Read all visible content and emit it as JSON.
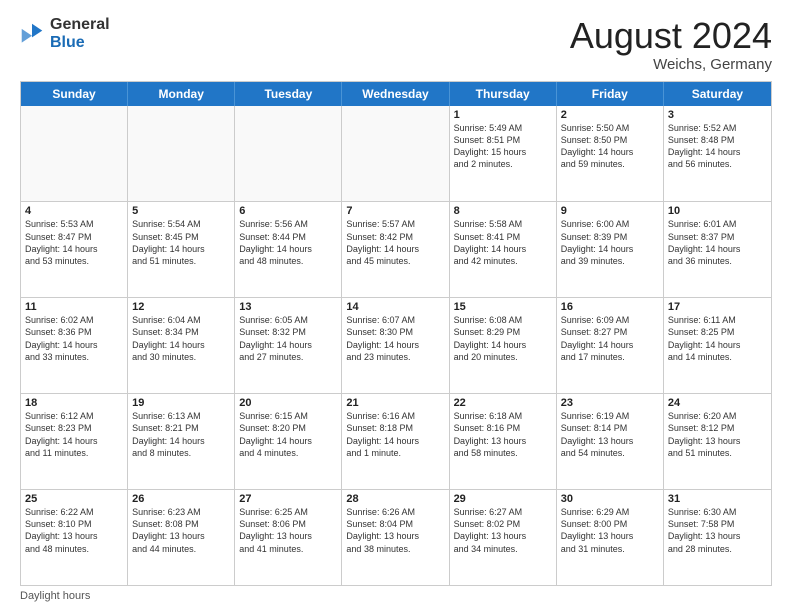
{
  "logo": {
    "general": "General",
    "blue": "Blue"
  },
  "header": {
    "month": "August 2024",
    "location": "Weichs, Germany"
  },
  "days_of_week": [
    "Sunday",
    "Monday",
    "Tuesday",
    "Wednesday",
    "Thursday",
    "Friday",
    "Saturday"
  ],
  "footer": "Daylight hours",
  "weeks": [
    [
      {
        "num": "",
        "info": ""
      },
      {
        "num": "",
        "info": ""
      },
      {
        "num": "",
        "info": ""
      },
      {
        "num": "",
        "info": ""
      },
      {
        "num": "1",
        "info": "Sunrise: 5:49 AM\nSunset: 8:51 PM\nDaylight: 15 hours\nand 2 minutes."
      },
      {
        "num": "2",
        "info": "Sunrise: 5:50 AM\nSunset: 8:50 PM\nDaylight: 14 hours\nand 59 minutes."
      },
      {
        "num": "3",
        "info": "Sunrise: 5:52 AM\nSunset: 8:48 PM\nDaylight: 14 hours\nand 56 minutes."
      }
    ],
    [
      {
        "num": "4",
        "info": "Sunrise: 5:53 AM\nSunset: 8:47 PM\nDaylight: 14 hours\nand 53 minutes."
      },
      {
        "num": "5",
        "info": "Sunrise: 5:54 AM\nSunset: 8:45 PM\nDaylight: 14 hours\nand 51 minutes."
      },
      {
        "num": "6",
        "info": "Sunrise: 5:56 AM\nSunset: 8:44 PM\nDaylight: 14 hours\nand 48 minutes."
      },
      {
        "num": "7",
        "info": "Sunrise: 5:57 AM\nSunset: 8:42 PM\nDaylight: 14 hours\nand 45 minutes."
      },
      {
        "num": "8",
        "info": "Sunrise: 5:58 AM\nSunset: 8:41 PM\nDaylight: 14 hours\nand 42 minutes."
      },
      {
        "num": "9",
        "info": "Sunrise: 6:00 AM\nSunset: 8:39 PM\nDaylight: 14 hours\nand 39 minutes."
      },
      {
        "num": "10",
        "info": "Sunrise: 6:01 AM\nSunset: 8:37 PM\nDaylight: 14 hours\nand 36 minutes."
      }
    ],
    [
      {
        "num": "11",
        "info": "Sunrise: 6:02 AM\nSunset: 8:36 PM\nDaylight: 14 hours\nand 33 minutes."
      },
      {
        "num": "12",
        "info": "Sunrise: 6:04 AM\nSunset: 8:34 PM\nDaylight: 14 hours\nand 30 minutes."
      },
      {
        "num": "13",
        "info": "Sunrise: 6:05 AM\nSunset: 8:32 PM\nDaylight: 14 hours\nand 27 minutes."
      },
      {
        "num": "14",
        "info": "Sunrise: 6:07 AM\nSunset: 8:30 PM\nDaylight: 14 hours\nand 23 minutes."
      },
      {
        "num": "15",
        "info": "Sunrise: 6:08 AM\nSunset: 8:29 PM\nDaylight: 14 hours\nand 20 minutes."
      },
      {
        "num": "16",
        "info": "Sunrise: 6:09 AM\nSunset: 8:27 PM\nDaylight: 14 hours\nand 17 minutes."
      },
      {
        "num": "17",
        "info": "Sunrise: 6:11 AM\nSunset: 8:25 PM\nDaylight: 14 hours\nand 14 minutes."
      }
    ],
    [
      {
        "num": "18",
        "info": "Sunrise: 6:12 AM\nSunset: 8:23 PM\nDaylight: 14 hours\nand 11 minutes."
      },
      {
        "num": "19",
        "info": "Sunrise: 6:13 AM\nSunset: 8:21 PM\nDaylight: 14 hours\nand 8 minutes."
      },
      {
        "num": "20",
        "info": "Sunrise: 6:15 AM\nSunset: 8:20 PM\nDaylight: 14 hours\nand 4 minutes."
      },
      {
        "num": "21",
        "info": "Sunrise: 6:16 AM\nSunset: 8:18 PM\nDaylight: 14 hours\nand 1 minute."
      },
      {
        "num": "22",
        "info": "Sunrise: 6:18 AM\nSunset: 8:16 PM\nDaylight: 13 hours\nand 58 minutes."
      },
      {
        "num": "23",
        "info": "Sunrise: 6:19 AM\nSunset: 8:14 PM\nDaylight: 13 hours\nand 54 minutes."
      },
      {
        "num": "24",
        "info": "Sunrise: 6:20 AM\nSunset: 8:12 PM\nDaylight: 13 hours\nand 51 minutes."
      }
    ],
    [
      {
        "num": "25",
        "info": "Sunrise: 6:22 AM\nSunset: 8:10 PM\nDaylight: 13 hours\nand 48 minutes."
      },
      {
        "num": "26",
        "info": "Sunrise: 6:23 AM\nSunset: 8:08 PM\nDaylight: 13 hours\nand 44 minutes."
      },
      {
        "num": "27",
        "info": "Sunrise: 6:25 AM\nSunset: 8:06 PM\nDaylight: 13 hours\nand 41 minutes."
      },
      {
        "num": "28",
        "info": "Sunrise: 6:26 AM\nSunset: 8:04 PM\nDaylight: 13 hours\nand 38 minutes."
      },
      {
        "num": "29",
        "info": "Sunrise: 6:27 AM\nSunset: 8:02 PM\nDaylight: 13 hours\nand 34 minutes."
      },
      {
        "num": "30",
        "info": "Sunrise: 6:29 AM\nSunset: 8:00 PM\nDaylight: 13 hours\nand 31 minutes."
      },
      {
        "num": "31",
        "info": "Sunrise: 6:30 AM\nSunset: 7:58 PM\nDaylight: 13 hours\nand 28 minutes."
      }
    ]
  ]
}
